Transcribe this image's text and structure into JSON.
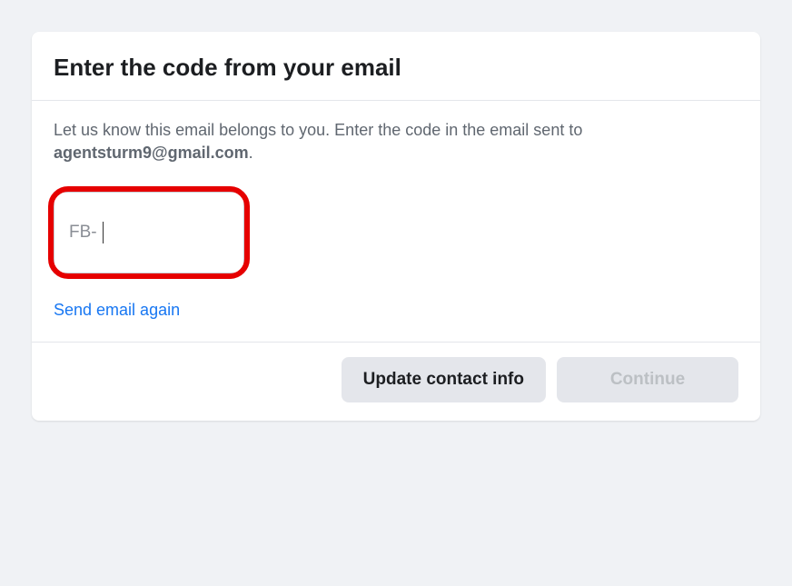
{
  "dialog": {
    "title": "Enter the code from your email",
    "instruction_prefix": "Let us know this email belongs to you. Enter the code in the email sent to ",
    "email": "agentsturm9@gmail.com",
    "instruction_suffix": "."
  },
  "code_input": {
    "prefix": "FB-",
    "value": ""
  },
  "links": {
    "resend": "Send email again"
  },
  "buttons": {
    "update_contact": "Update contact info",
    "continue": "Continue"
  }
}
